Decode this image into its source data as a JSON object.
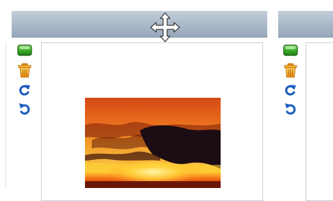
{
  "panels": [
    {
      "header": {
        "move_icon": "move-arrows-icon"
      },
      "toolbar": [
        {
          "name": "status",
          "icon": "green-status-icon",
          "color": "#3cb029"
        },
        {
          "name": "delete",
          "icon": "trash-icon",
          "color": "#f0a21c"
        },
        {
          "name": "refresh",
          "icon": "refresh-icon",
          "color": "#1f5fc0"
        },
        {
          "name": "undo",
          "icon": "undo-icon",
          "color": "#1f5fc0"
        }
      ],
      "content": {
        "image": "sunset-photo"
      }
    },
    {
      "header": {},
      "toolbar": [
        {
          "name": "status",
          "icon": "green-status-icon",
          "color": "#3cb029"
        },
        {
          "name": "delete",
          "icon": "trash-icon",
          "color": "#f0a21c"
        },
        {
          "name": "refresh",
          "icon": "refresh-icon",
          "color": "#1f5fc0"
        },
        {
          "name": "undo",
          "icon": "undo-icon",
          "color": "#1f5fc0"
        }
      ],
      "content": {}
    }
  ],
  "colors": {
    "header_gradient": [
      "#c3ced9",
      "#97a8ba"
    ],
    "frame_border": "#c4d0dc"
  }
}
